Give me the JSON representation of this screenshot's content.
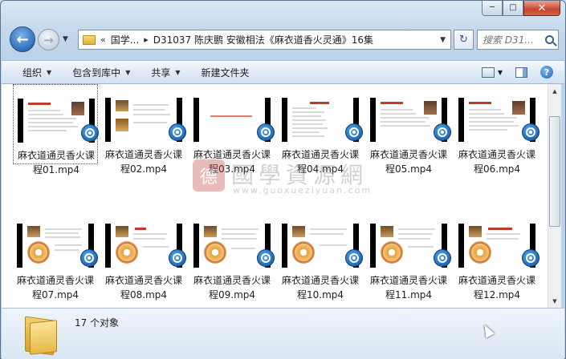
{
  "window": {
    "minimize_glyph": "─",
    "maximize_glyph": "□",
    "close_glyph": "✕"
  },
  "nav": {
    "back_glyph": "←",
    "forward_glyph": "→",
    "dropdown_glyph": "▼"
  },
  "address": {
    "overflow": "«",
    "crumb1": "国学...",
    "separator": "▸",
    "crumb2": "D31037 陈庆鹏 安徽相法《麻衣道香火灵通》16集",
    "dropdown_glyph": "▼",
    "refresh_glyph": "↻"
  },
  "search": {
    "placeholder": "搜索 D31..."
  },
  "toolbar": {
    "organize": "组织",
    "include_in_library": "包含到库中",
    "share": "共享",
    "new_folder": "新建文件夹",
    "help": "?"
  },
  "files": [
    {
      "line1": "麻衣道通灵香火课",
      "line2": "程01.mp4"
    },
    {
      "line1": "麻衣道通灵香火课",
      "line2": "程02.mp4"
    },
    {
      "line1": "麻衣道通灵香火课",
      "line2": "程03.mp4"
    },
    {
      "line1": "麻衣道通灵香火课",
      "line2": "程04.mp4"
    },
    {
      "line1": "麻衣道通灵香火课",
      "line2": "程05.mp4"
    },
    {
      "line1": "麻衣道通灵香火课",
      "line2": "程06.mp4"
    },
    {
      "line1": "麻衣道通灵香火课",
      "line2": "程07.mp4"
    },
    {
      "line1": "麻衣道通灵香火课",
      "line2": "程08.mp4"
    },
    {
      "line1": "麻衣道通灵香火课",
      "line2": "程09.mp4"
    },
    {
      "line1": "麻衣道通灵香火课",
      "line2": "程10.mp4"
    },
    {
      "line1": "麻衣道通灵香火课",
      "line2": "程11.mp4"
    },
    {
      "line1": "麻衣道通灵香火课",
      "line2": "程12.mp4"
    }
  ],
  "watermark": {
    "seal": "德",
    "name": "國學資源網",
    "url": "www.guoxueziyuan.com"
  },
  "scrollbar": {
    "up_glyph": "▲",
    "down_glyph": "▼"
  },
  "details": {
    "status": "17 个对象"
  }
}
